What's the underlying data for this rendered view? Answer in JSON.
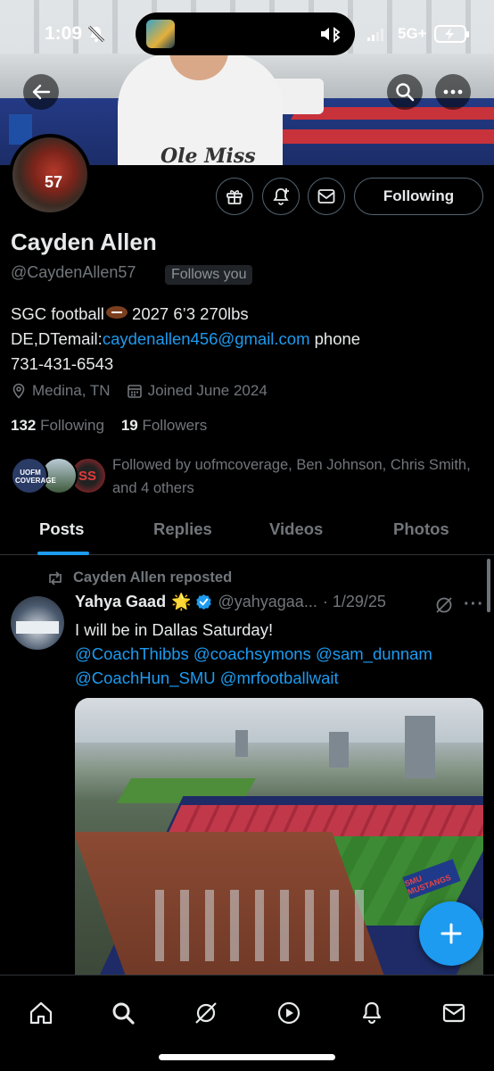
{
  "status_bar": {
    "time": "1:09",
    "network": "5G+"
  },
  "profile": {
    "display_name": "Cayden Allen",
    "handle": "@CaydenAllen57",
    "follows_you": "Follows you",
    "following_button": "Following",
    "bio_line1": "SGC football",
    "bio_line1_rest": " 2027 6’3 270lbs",
    "bio_line2_prefix": "DE,DTemail:",
    "bio_email": "caydenallen456@gmail.com",
    "bio_line2_suffix": " phone",
    "bio_line3": "731-431-6543",
    "location": "Medina, TN",
    "joined": "Joined June 2024",
    "following_count": "132",
    "following_label": " Following",
    "followers_count": "19",
    "followers_label": " Followers",
    "followed_by": "Followed by uofmcoverage, Ben Johnson, Chris Smith, and 4 others",
    "followed_avatar_1_text": "UOFM COVERAGE",
    "followed_avatar_3_text": "SS"
  },
  "tabs": [
    {
      "label": "Posts",
      "active": true
    },
    {
      "label": "Replies",
      "active": false
    },
    {
      "label": "Videos",
      "active": false
    },
    {
      "label": "Photos",
      "active": false
    }
  ],
  "post": {
    "repost_label": "Cayden Allen reposted",
    "author": "Yahya Gaad",
    "author_badge": "🌟",
    "handle": "@yahyagaa...",
    "date": "· 1/29/25",
    "text": "I will be in Dallas Saturday!",
    "mentions_line1": "@CoachThibbs @coachsymons @sam_dunnam",
    "mentions_line2": "@CoachHun_SMU @mrfootballwait",
    "image_sign_text": "SMU MUSTANGS"
  },
  "icons": {
    "back": "arrow-left-icon",
    "search": "search-icon",
    "more": "more-icon",
    "gift": "gift-icon",
    "notify": "bell-plus-icon",
    "mail": "mail-icon",
    "location": "location-pin-icon",
    "calendar": "calendar-icon",
    "repost": "repost-icon",
    "verified": "verified-badge-icon",
    "grok": "grok-icon",
    "compose": "plus-icon"
  },
  "colors": {
    "accent": "#1d9bf0",
    "background": "#000000",
    "text": "#e7e9ea",
    "muted": "#71767b"
  }
}
